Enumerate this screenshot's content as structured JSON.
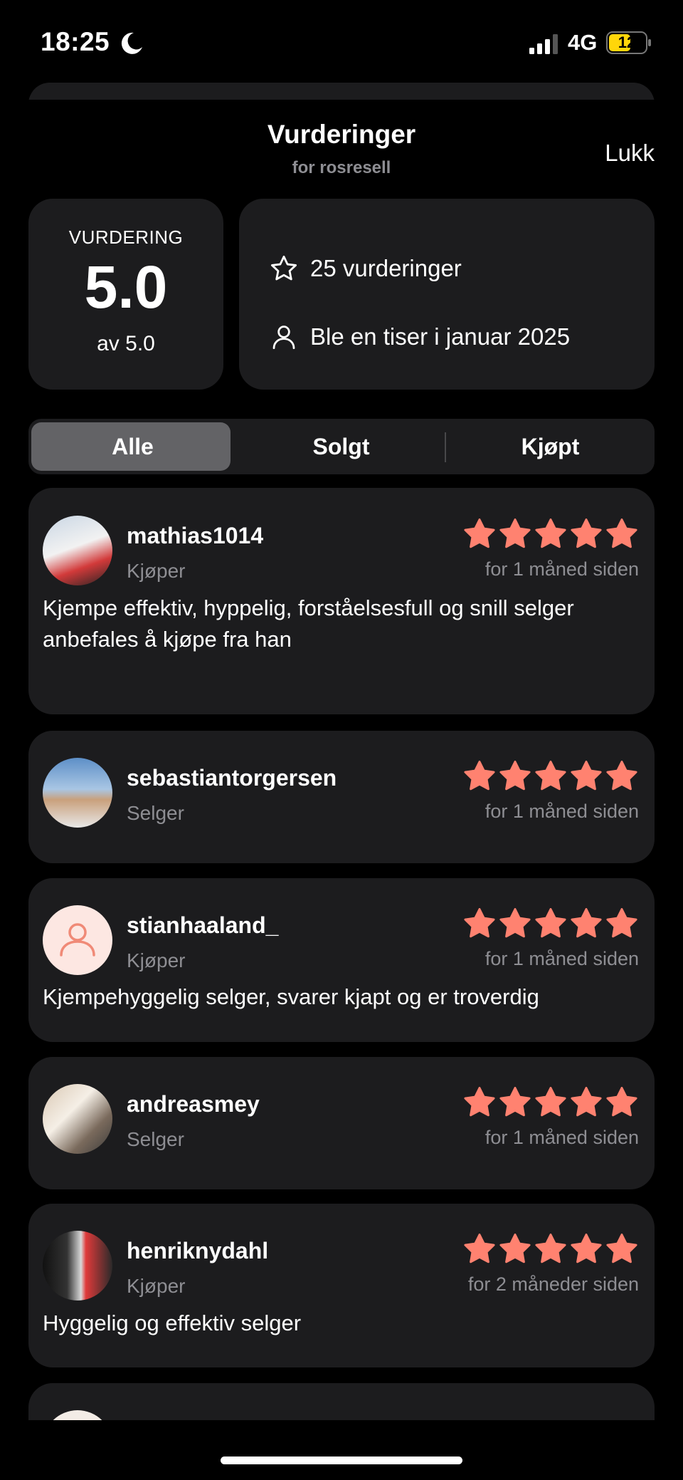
{
  "status": {
    "time": "18:25",
    "network": "4G",
    "battery": "12"
  },
  "header": {
    "title": "Vurderinger",
    "subtitle": "for rosresell",
    "close_label": "Lukk"
  },
  "rating": {
    "label": "VURDERING",
    "value": "5.0",
    "of": "av 5.0"
  },
  "info": {
    "count": "25 vurderinger",
    "joined": "Ble en tiser i januar 2025"
  },
  "tabs": [
    {
      "label": "Alle",
      "selected": true
    },
    {
      "label": "Solgt",
      "selected": false
    },
    {
      "label": "Kjøpt",
      "selected": false
    }
  ],
  "accent": "#ff8270",
  "reviews": [
    {
      "user": "mathias1014",
      "role": "Kjøper",
      "time": "for 1 måned siden",
      "stars": 5,
      "text": "Kjempe effektiv, hyppelig, forståelsesfull og snill selger anbefales å kjøpe fra han"
    },
    {
      "user": "sebastiantorgersen",
      "role": "Selger",
      "time": "for 1 måned siden",
      "stars": 5,
      "text": ""
    },
    {
      "user": "stianhaaland_",
      "role": "Kjøper",
      "time": "for 1 måned siden",
      "stars": 5,
      "text": "Kjempehyggelig selger, svarer kjapt og er troverdig"
    },
    {
      "user": "andreasmey",
      "role": "Selger",
      "time": "for 1 måned siden",
      "stars": 5,
      "text": ""
    },
    {
      "user": "henriknydahl",
      "role": "Kjøper",
      "time": "for 2 måneder siden",
      "stars": 5,
      "text": "Hyggelig og effektiv selger"
    }
  ]
}
